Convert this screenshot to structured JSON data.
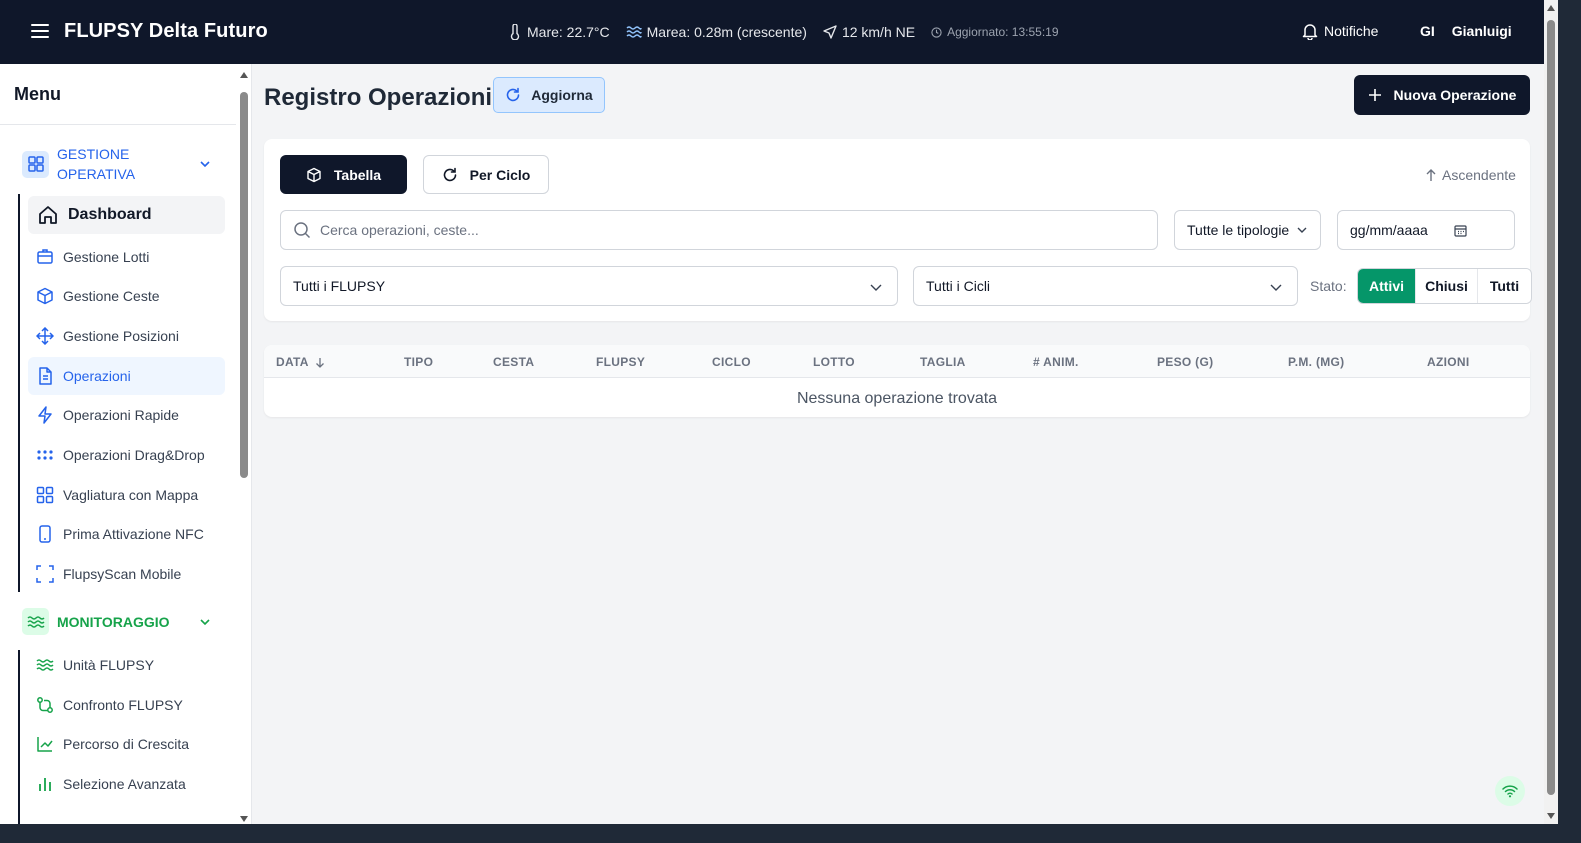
{
  "header": {
    "app_title": "FLUPSY Delta Futuro",
    "weather": {
      "sea_temp": "Mare: 22.7°C",
      "tide": "Marea: 0.28m (crescente)",
      "wind": "12 km/h NE",
      "updated": "Aggiornato: 13:55:19"
    },
    "notifications_label": "Notifiche",
    "user_initials": "GI",
    "user_name": "Gianluigi"
  },
  "sidebar": {
    "title": "Menu",
    "sections": [
      {
        "label": "GESTIONE OPERATIVA",
        "color": "#2563eb",
        "items": [
          {
            "label": "Dashboard",
            "icon": "home-icon"
          },
          {
            "label": "Gestione Lotti",
            "icon": "box-icon"
          },
          {
            "label": "Gestione Ceste",
            "icon": "package-icon"
          },
          {
            "label": "Gestione Posizioni",
            "icon": "move-icon"
          },
          {
            "label": "Operazioni",
            "icon": "document-icon",
            "active": true
          },
          {
            "label": "Operazioni Rapide",
            "icon": "zap-icon"
          },
          {
            "label": "Operazioni Drag&Drop",
            "icon": "grip-icon"
          },
          {
            "label": "Vagliatura con Mappa",
            "icon": "grid-icon"
          },
          {
            "label": "Prima Attivazione NFC",
            "icon": "phone-icon"
          },
          {
            "label": "FlupsyScan Mobile",
            "icon": "scan-icon"
          }
        ]
      },
      {
        "label": "MONITORAGGIO",
        "color": "#16a34a",
        "items": [
          {
            "label": "Unità FLUPSY",
            "icon": "waves-icon"
          },
          {
            "label": "Confronto FLUPSY",
            "icon": "git-compare-icon"
          },
          {
            "label": "Percorso di Crescita",
            "icon": "line-chart-icon"
          },
          {
            "label": "Selezione Avanzata",
            "icon": "bar-chart-icon"
          }
        ]
      }
    ]
  },
  "main": {
    "page_title": "Registro Operazioni",
    "refresh_label": "Aggiorna",
    "new_operation_label": "Nuova Operazione",
    "view_tabs": {
      "table": "Tabella",
      "cycle": "Per Ciclo"
    },
    "sort_label": "Ascendente",
    "search_placeholder": "Cerca operazioni, ceste...",
    "type_select": "Tutte le tipologie",
    "date_placeholder": "gg/mm/aaaa",
    "flupsy_select": "Tutti i FLUPSY",
    "cycle_select": "Tutti i Cicli",
    "status_label": "Stato:",
    "status_options": [
      "Attivi",
      "Chiusi",
      "Tutti"
    ],
    "status_selected": "Attivi",
    "accent_green": "#059669",
    "table": {
      "columns": [
        "DATA",
        "TIPO",
        "CESTA",
        "FLUPSY",
        "CICLO",
        "LOTTO",
        "TAGLIA",
        "# ANIM.",
        "PESO (G)",
        "P.M. (MG)",
        "AZIONI"
      ],
      "empty_message": "Nessuna operazione trovata"
    }
  }
}
